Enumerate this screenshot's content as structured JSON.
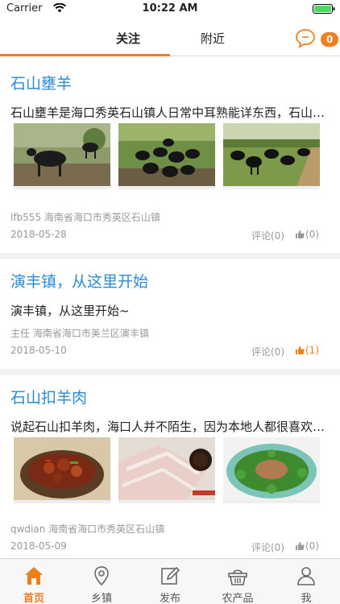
{
  "status_bar": {
    "carrier": "Carrier",
    "time": "10:22 AM"
  },
  "nav": {
    "tabs": [
      {
        "label": "关注",
        "active": true
      },
      {
        "label": "附近",
        "active": false
      }
    ],
    "message_count": "0"
  },
  "feed": {
    "posts": [
      {
        "title": "石山壅羊",
        "text": "石山壅羊是海口秀英石山镇人日常中耳熟能详东西，石山壅羊",
        "author_location": "lfb555 海南省海口市秀英区石山镇",
        "date": "2018-05-28",
        "comments": "评论(0)",
        "likes": "(0)"
      },
      {
        "title": "演丰镇，从这里开始",
        "text": "演丰镇，从这里开始~",
        "author_location": "主任 海南省海口市美兰区演丰镇",
        "date": "2018-05-10",
        "comments": "评论(0)",
        "likes": "(1)"
      },
      {
        "title": "石山扣羊肉",
        "text": "说起石山扣羊肉，海口人并不陌生，因为本地人都很喜欢吃扣羊肉",
        "author_location": "qwdian 海南省海口市秀英区石山镇",
        "date": "2018-05-09",
        "comments": "评论(0)",
        "likes": "(0)"
      }
    ]
  },
  "tabbar": {
    "items": [
      {
        "label": "首页",
        "icon": "home-icon",
        "active": true
      },
      {
        "label": "乡镇",
        "icon": "location-pin-icon",
        "active": false
      },
      {
        "label": "发布",
        "icon": "edit-icon",
        "active": false
      },
      {
        "label": "农产品",
        "icon": "basket-icon",
        "active": false
      },
      {
        "label": "我",
        "icon": "person-icon",
        "active": false
      }
    ]
  },
  "colors": {
    "accent": "#ef7e1f",
    "title_blue": "#2b8ad6",
    "meta_gray": "#999999"
  }
}
